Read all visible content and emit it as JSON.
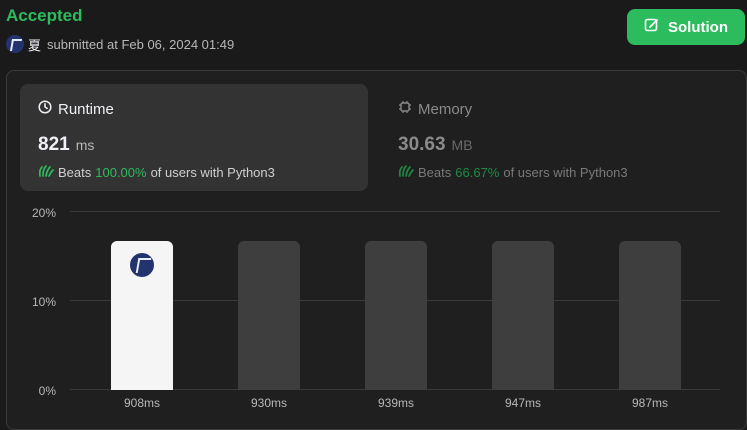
{
  "header": {
    "status": "Accepted",
    "username": "夏",
    "submitted_text": "submitted at Feb 06, 2024 01:49",
    "solution_label": "Solution"
  },
  "runtime": {
    "title": "Runtime",
    "value": "821",
    "unit": "ms",
    "beats_label": "Beats",
    "beats_pct": "100.00%",
    "beats_suffix": "of users with Python3"
  },
  "memory": {
    "title": "Memory",
    "value": "30.63",
    "unit": "MB",
    "beats_label": "Beats",
    "beats_pct": "66.67%",
    "beats_suffix": "of users with Python3"
  },
  "chart_data": {
    "type": "bar",
    "categories": [
      "908ms",
      "930ms",
      "939ms",
      "947ms",
      "987ms"
    ],
    "values": [
      16.67,
      16.67,
      16.67,
      16.67,
      16.67
    ],
    "yticks": [
      "20%",
      "10%",
      "0%"
    ],
    "ylim": [
      0,
      20
    ],
    "highlight_index": 0,
    "grid": true
  },
  "colors": {
    "accent": "#2cbb5d",
    "bar": "#3e3e3e",
    "bar_current": "#f5f5f5"
  }
}
